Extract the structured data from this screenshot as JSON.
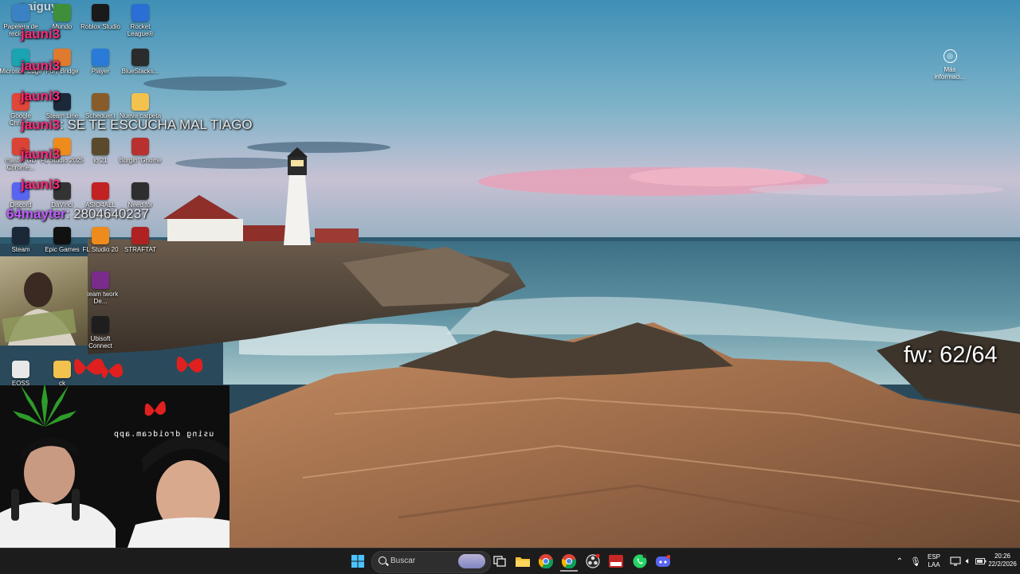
{
  "stream": {
    "title": "naiguy",
    "fw_counter": "fw: 62/64",
    "chat": [
      {
        "user": "jauni3",
        "message": ""
      },
      {
        "user": "jauni3",
        "message": ""
      },
      {
        "user": "jauni3",
        "message": ""
      },
      {
        "user": "jauni3",
        "message": "SE TE ESCUCHA MAL TIAGO"
      },
      {
        "user": "jauni3",
        "message": ""
      },
      {
        "user": "jauni3",
        "message": ""
      },
      {
        "user": "64mayter",
        "message": "2804640237"
      }
    ],
    "droidcam_watermark": "using droidcam.app"
  },
  "desktop": {
    "icons": [
      {
        "label": "Papelera de reciclaje",
        "icon": "recycle-bin-icon",
        "color": "#3b82c4"
      },
      {
        "label": "Mundo",
        "icon": "game-icon",
        "color": "#3f8f3a"
      },
      {
        "label": "Roblox Studio",
        "icon": "roblox-icon",
        "color": "#1a1a1a"
      },
      {
        "label": "Rocket League®",
        "icon": "rocket-league-icon",
        "color": "#2b6fd6"
      },
      {
        "label": "Microsoft Edge",
        "icon": "edge-icon",
        "color": "#1aa3b0"
      },
      {
        "label": "Poly Bridge",
        "icon": "poly-bridge-icon",
        "color": "#e07a2e"
      },
      {
        "label": "Player",
        "icon": "roblox-player-icon",
        "color": "#2a7bd8"
      },
      {
        "label": "BlueStacks...",
        "icon": "bluestacks-icon",
        "color": "#2b2b2b"
      },
      {
        "label": "Google Chrome",
        "icon": "chrome-icon",
        "color": "#e0463a"
      },
      {
        "label": "Steam Line",
        "icon": "steam-icon",
        "color": "#1b2838"
      },
      {
        "label": "Schedule I",
        "icon": "game-icon",
        "color": "#8a5b2a"
      },
      {
        "label": "Nueva carpeta",
        "icon": "folder-icon",
        "color": "#f2c14e"
      },
      {
        "label": "master GD Chrome...",
        "icon": "chrome-icon",
        "color": "#d94436"
      },
      {
        "label": "FL Studio 2025",
        "icon": "fl-studio-icon",
        "color": "#ef8b1d"
      },
      {
        "label": "io 21",
        "icon": "game-icon",
        "color": "#5a4a2c"
      },
      {
        "label": "Burgin' Gnome",
        "icon": "game-icon",
        "color": "#b8312f"
      },
      {
        "label": "Discord",
        "icon": "discord-icon",
        "color": "#5865f2"
      },
      {
        "label": "DaVinci",
        "icon": "davinci-icon",
        "color": "#333333"
      },
      {
        "label": "ASIO4ALL",
        "icon": "asio-icon",
        "color": "#c22222"
      },
      {
        "label": "Need for",
        "icon": "game-icon",
        "color": "#2e2e2e"
      },
      {
        "label": "Steam",
        "icon": "steam-icon",
        "color": "#1b2838"
      },
      {
        "label": "Epic Games",
        "icon": "epic-games-icon",
        "color": "#111111"
      },
      {
        "label": "FL Studio 20",
        "icon": "fl-studio-icon",
        "color": "#ef8b1d"
      },
      {
        "label": "STRAFTAT",
        "icon": "game-icon",
        "color": "#b02222"
      },
      {
        "label": "Steam twork De...",
        "icon": "winrar-icon",
        "color": "#7a2b8c"
      },
      {
        "label": "Ubisoft Connect",
        "icon": "ubisoft-icon",
        "color": "#1e1e1e"
      },
      {
        "label": "EOSS",
        "icon": "file-icon",
        "color": "#e8e8e8"
      },
      {
        "label": "ck",
        "icon": "folder-icon",
        "color": "#f2c14e"
      }
    ],
    "info_widget": {
      "label": "Más informaci...",
      "icon": "camera-info-icon"
    }
  },
  "taskbar": {
    "search_placeholder": "Buscar",
    "apps": [
      "windows-start-icon",
      "task-view-icon",
      "file-explorer-icon",
      "chrome-icon",
      "chrome-icon",
      "obs-icon",
      "tutorial-icon",
      "whatsapp-icon",
      "discord-icon"
    ],
    "tray": {
      "language": "ESP",
      "layout": "LAA",
      "time": "20:26",
      "date": "22/2/2026"
    }
  }
}
